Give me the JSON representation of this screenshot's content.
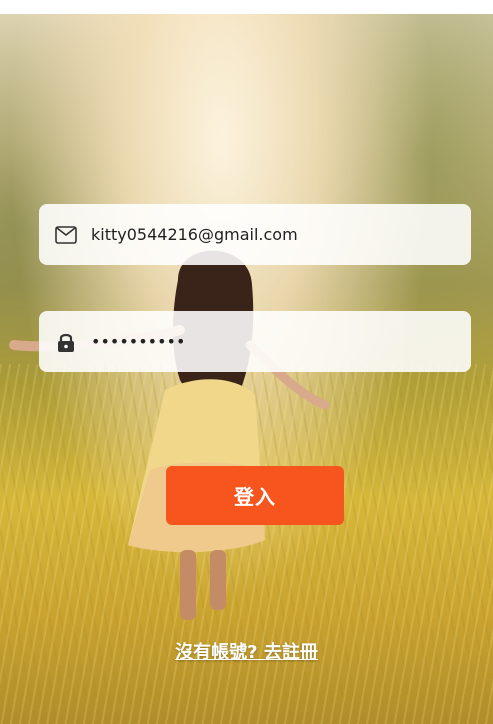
{
  "login": {
    "email_value": "kitty0544216@gmail.com",
    "password_masked": "••••••••••",
    "login_label": "登入",
    "register_label": "沒有帳號? 去註冊"
  },
  "icons": {
    "email": "envelope-icon",
    "password": "lock-icon"
  },
  "colors": {
    "login_button": "#f7551e",
    "field_background": "#ffffff",
    "link_text": "#ffffff"
  }
}
